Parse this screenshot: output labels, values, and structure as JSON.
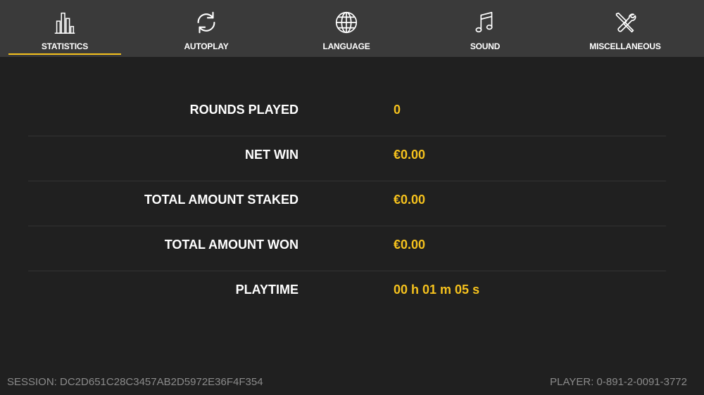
{
  "tabs": [
    {
      "label": "STATISTICS",
      "icon": "bar-chart-icon",
      "active": true
    },
    {
      "label": "AUTOPLAY",
      "icon": "refresh-icon",
      "active": false
    },
    {
      "label": "LANGUAGE",
      "icon": "globe-icon",
      "active": false
    },
    {
      "label": "SOUND",
      "icon": "music-note-icon",
      "active": false
    },
    {
      "label": "MISCELLANEOUS",
      "icon": "tools-icon",
      "active": false
    }
  ],
  "stats": [
    {
      "label": "ROUNDS PLAYED",
      "value": "0"
    },
    {
      "label": "NET WIN",
      "value": "€0.00"
    },
    {
      "label": "TOTAL AMOUNT STAKED",
      "value": "€0.00"
    },
    {
      "label": "TOTAL AMOUNT WON",
      "value": "€0.00"
    },
    {
      "label": "PLAYTIME",
      "value": "00 h 01 m 05 s"
    }
  ],
  "footer": {
    "session": "SESSION: DC2D651C28C3457AB2D5972E36F4F354",
    "player": "PLAYER: 0-891-2-0091-3772"
  },
  "colors": {
    "accent": "#f6c21d",
    "background": "#202020",
    "topbar": "#3a3a3a"
  }
}
